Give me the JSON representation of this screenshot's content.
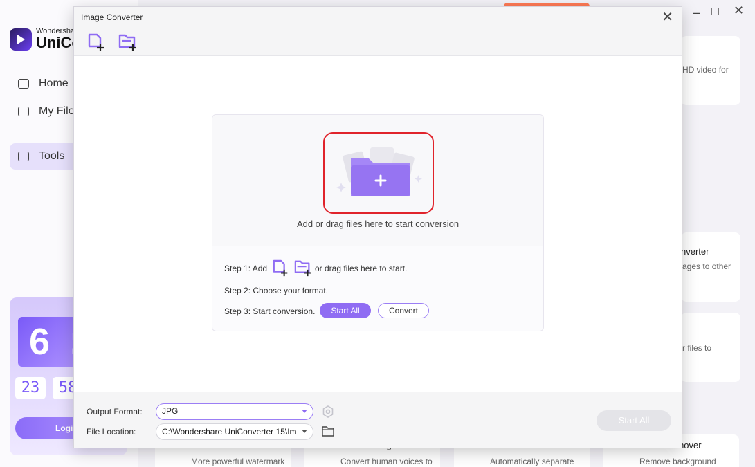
{
  "background": {
    "logo": {
      "brand_top": "Wondersha",
      "brand_main": "UniCo"
    },
    "nav": [
      {
        "label": "Home",
        "icon": "home-icon"
      },
      {
        "label": "My File",
        "icon": "folder-icon"
      },
      {
        "label": "Tools",
        "icon": "toolbox-icon"
      }
    ],
    "promo": {
      "day": "6",
      "day_label": "Da",
      "day_sub": "F",
      "hours": "23",
      "minutes": "58",
      "login": "Logi"
    },
    "cards": {
      "hd_text": "HD video for",
      "converter_title": "nverter",
      "converter_text": "ages to other",
      "files_text": "r files to",
      "bottom": [
        {
          "title": "Remove Watermark ...",
          "text": "More powerful watermark"
        },
        {
          "title": "Voice Changer",
          "text": "Convert human voices to"
        },
        {
          "title": "Vocal Remover",
          "text": "Automatically separate"
        },
        {
          "title": "Noise Remover",
          "text": "Remove background"
        }
      ]
    }
  },
  "dialog": {
    "title": "Image Converter",
    "close_icon": "close-icon",
    "toolbar": {
      "add_file_icon": "add-file-icon",
      "add_folder_icon": "add-folder-icon"
    },
    "drop_zone": {
      "text": "Add or drag files here to start conversion"
    },
    "steps": {
      "step1_prefix": "Step 1: Add",
      "step1_suffix": "or drag files here to start.",
      "step2": "Step 2: Choose your format.",
      "step3": "Step 3: Start conversion.",
      "start_all": "Start All",
      "convert": "Convert"
    },
    "footer": {
      "output_format_label": "Output Format:",
      "output_format_value": "JPG",
      "file_location_label": "File Location:",
      "file_location_value": "C:\\Wondershare UniConverter 15\\Im",
      "start_all": "Start All"
    }
  },
  "colors": {
    "accent": "#8f6cf3",
    "highlight": "#e0232b"
  }
}
